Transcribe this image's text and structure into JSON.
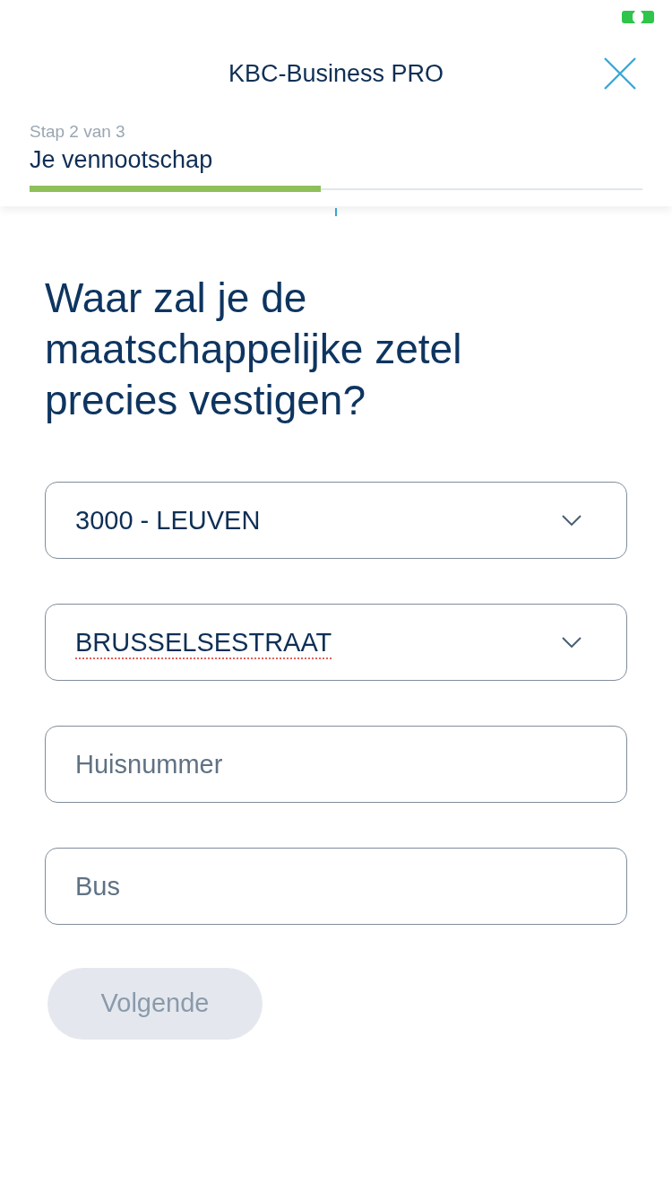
{
  "header": {
    "title": "KBC-Business PRO"
  },
  "progress": {
    "step_label": "Stap 2 van 3",
    "section": "Je vennootschap",
    "level": 0.475
  },
  "question": "Waar zal je de maatschappelijke zetel precies vestigen?",
  "fields": [
    {
      "kind": "select",
      "value": "3000 - LEUVEN",
      "spell_error": false
    },
    {
      "kind": "select",
      "value": "BRUSSELSESTRAAT",
      "spell_error": true
    },
    {
      "kind": "input",
      "placeholder": "Huisnummer"
    },
    {
      "kind": "input",
      "placeholder": "Bus"
    }
  ],
  "next_button": {
    "label": "Volgende",
    "disabled": true
  }
}
